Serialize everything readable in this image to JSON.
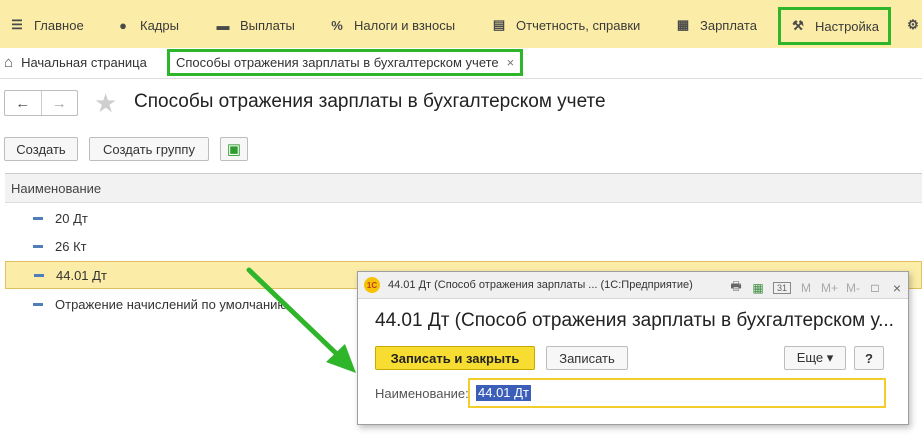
{
  "sections": [
    {
      "label": "Главное",
      "icon": "menu-icon",
      "glyph": "☰"
    },
    {
      "label": "Кадры",
      "icon": "users-icon",
      "glyph": "👥"
    },
    {
      "label": "Выплаты",
      "icon": "wallet-icon",
      "glyph": "▬"
    },
    {
      "label": "Налоги и взносы",
      "icon": "percent-icon",
      "glyph": "%"
    },
    {
      "label": "Отчетность, справки",
      "icon": "documents-icon",
      "glyph": "▤"
    },
    {
      "label": "Зарплата",
      "icon": "calculator-icon",
      "glyph": "▦"
    },
    {
      "label": "Настройка",
      "icon": "wrench-icon",
      "glyph": "🔧"
    }
  ],
  "gear_glyph": "⚙",
  "tabs": {
    "home_label": "Начальная страница",
    "home_glyph": "⌂",
    "active_label": "Способы отражения зарплаты в бухгалтерском учете",
    "close_glyph": "×"
  },
  "page": {
    "back_glyph": "←",
    "forward_glyph": "→",
    "star_glyph": "★",
    "title": "Способы отражения зарплаты в бухгалтерском учете"
  },
  "toolbar": {
    "create_label": "Создать",
    "create_group_label": "Создать группу",
    "excel_glyph": "▣"
  },
  "list": {
    "column_header": "Наименование",
    "rows": [
      {
        "label": "20 Дт"
      },
      {
        "label": "26 Кт"
      },
      {
        "label": "44.01 Дт"
      },
      {
        "label": "Отражение начислений по умолчанию"
      }
    ]
  },
  "dialog": {
    "window_title": "44.01 Дт (Способ отражения зарплаты ...  (1С:Предприятие)",
    "logo_text": "1С",
    "toolbar_glyphs": [
      "🖶",
      "▦",
      "31",
      "M",
      "M+",
      "M-",
      "□",
      "×"
    ],
    "heading": "44.01 Дт (Способ отражения зарплаты в бухгалтерском у...",
    "save_close_label": "Записать и закрыть",
    "save_label": "Записать",
    "more_label": "Еще ▾",
    "help_label": "?",
    "field_label": "Наименование:",
    "field_value": "44.01 Дт"
  },
  "colors": {
    "topbar": "#fbeda7",
    "highlight_green": "#2fb52a",
    "primary_button": "#f7dd32",
    "selection_blue": "#3b5fb8"
  }
}
